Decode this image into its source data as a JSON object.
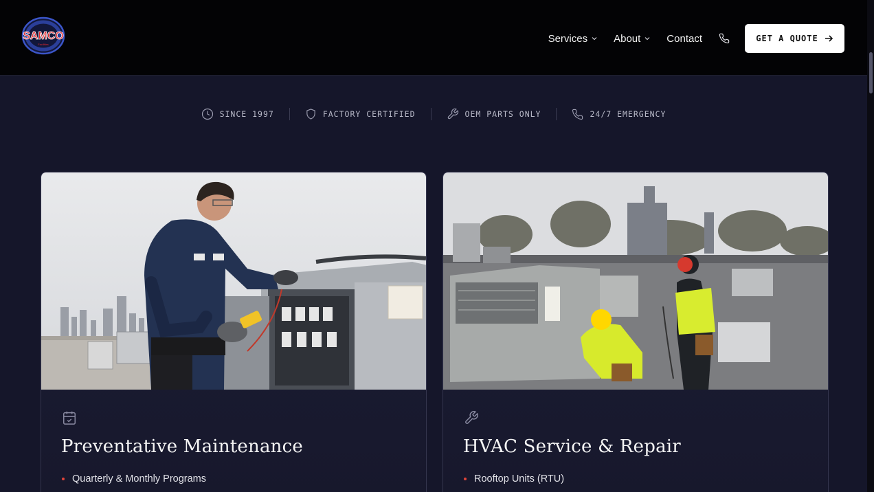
{
  "header": {
    "logo": {
      "text": "SAMCO",
      "ring_text": "Since 1997 • HVAC Refrigeration",
      "sub_text": "Facilities"
    },
    "nav": [
      {
        "label": "Services",
        "has_dropdown": true
      },
      {
        "label": "About",
        "has_dropdown": true
      },
      {
        "label": "Contact",
        "has_dropdown": false
      }
    ],
    "phone_icon": "phone-icon",
    "cta_label": "GET A QUOTE"
  },
  "badges": [
    {
      "icon": "clock-icon",
      "label": "SINCE 1997"
    },
    {
      "icon": "shield-icon",
      "label": "FACTORY CERTIFIED"
    },
    {
      "icon": "wrench-icon",
      "label": "OEM PARTS ONLY"
    },
    {
      "icon": "phone-icon",
      "label": "24/7 EMERGENCY"
    }
  ],
  "cards": [
    {
      "icon": "calendar-check-icon",
      "title": "Preventative Maintenance",
      "items": [
        "Quarterly & Monthly Programs"
      ]
    },
    {
      "icon": "wrench-icon",
      "title": "HVAC Service & Repair",
      "items": [
        "Rooftop Units (RTU)"
      ]
    }
  ],
  "colors": {
    "background": "#15162a",
    "header": "#030305",
    "accent": "#e0443a",
    "logo_red": "#d8232a",
    "logo_blue": "#2b3f9a"
  }
}
